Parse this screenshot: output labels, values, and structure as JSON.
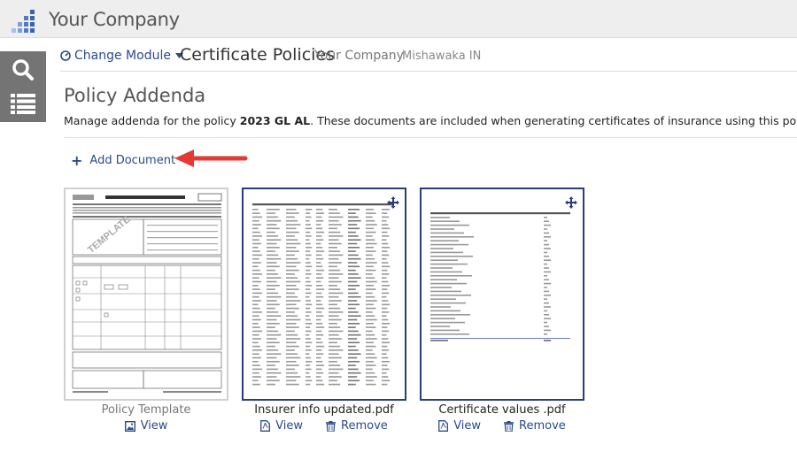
{
  "app": {
    "company_title": "Your Company"
  },
  "module": {
    "change_module_label": "Change Module",
    "title": "Certificate Policies",
    "company": "Your Company",
    "location": "Mishawaka IN"
  },
  "page": {
    "title": "Policy Addenda",
    "desc_prefix": "Manage addenda for the policy ",
    "policy_name": "2023 GL AL",
    "desc_suffix": ". These documents are included when generating certificates of insurance using this policy.",
    "add_document_label": "Add Document"
  },
  "documents": [
    {
      "name": "Policy Template",
      "view_label": "View"
    },
    {
      "name": "Insurer info updated.pdf",
      "view_label": "View",
      "remove_label": "Remove"
    },
    {
      "name": "Certificate values .pdf",
      "view_label": "View",
      "remove_label": "Remove"
    }
  ],
  "colors": {
    "accent": "#2a4a8a",
    "selected_border": "#2a3b7f",
    "arrow": "#e53935",
    "rail": "#747474"
  }
}
